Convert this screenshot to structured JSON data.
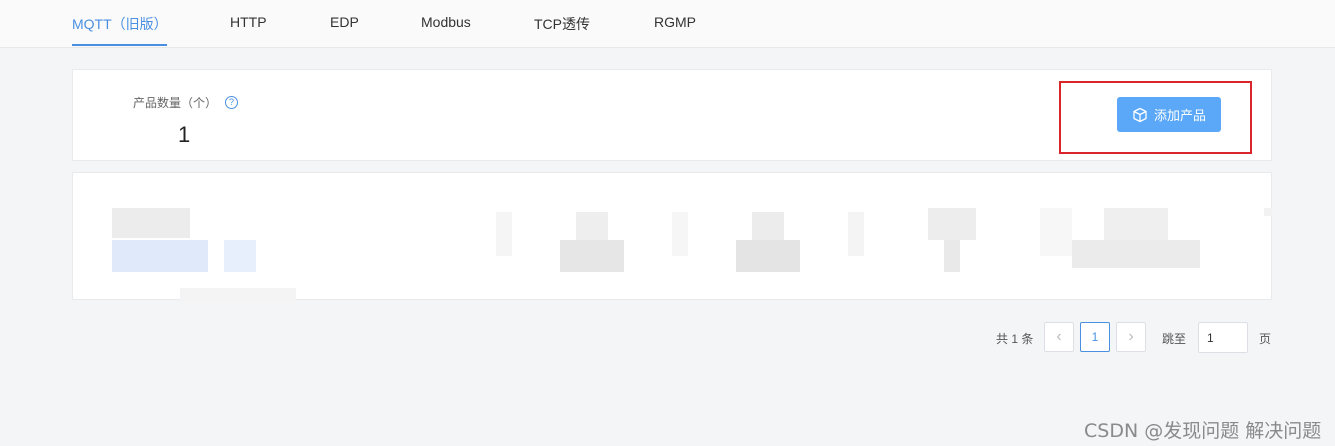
{
  "tabs": [
    {
      "label": "MQTT（旧版）",
      "active": true
    },
    {
      "label": "HTTP",
      "active": false
    },
    {
      "label": "EDP",
      "active": false
    },
    {
      "label": "Modbus",
      "active": false
    },
    {
      "label": "TCP透传",
      "active": false
    },
    {
      "label": "RGMP",
      "active": false
    }
  ],
  "stats": {
    "label": "产品数量（个）",
    "help_icon": "?",
    "value": "1"
  },
  "actions": {
    "add_product_label": "添加产品",
    "add_product_icon": "cube-icon"
  },
  "pagination": {
    "total_text": "共 1 条",
    "prev_icon": "‹",
    "next_icon": "›",
    "current_page": "1",
    "jump_label": "跳至",
    "jump_value": "1",
    "page_suffix": "页"
  },
  "watermark": "CSDN @发现问题 解决问题",
  "colors": {
    "accent": "#4a90e2",
    "button": "#5aa8f7",
    "highlight_box": "#d9262c"
  }
}
